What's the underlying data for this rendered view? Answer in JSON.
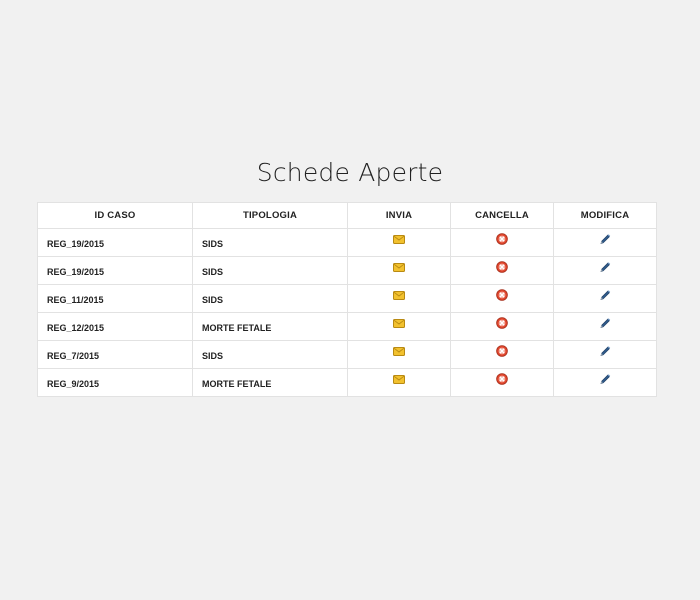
{
  "page": {
    "title": "Schede Aperte"
  },
  "table": {
    "headers": {
      "id_caso": "ID CASO",
      "tipologia": "TIPOLOGIA",
      "invia": "INVIA",
      "cancella": "CANCELLA",
      "modifica": "MODIFICA"
    },
    "rows": [
      {
        "id_caso": "REG_19/2015",
        "tipologia": "SIDS"
      },
      {
        "id_caso": "REG_19/2015",
        "tipologia": "SIDS"
      },
      {
        "id_caso": "REG_11/2015",
        "tipologia": "SIDS"
      },
      {
        "id_caso": "REG_12/2015",
        "tipologia": "MORTE FETALE"
      },
      {
        "id_caso": "REG_7/2015",
        "tipologia": "SIDS"
      },
      {
        "id_caso": "REG_9/2015",
        "tipologia": "MORTE FETALE"
      }
    ],
    "icons": {
      "invia": "envelope-icon",
      "cancella": "delete-circle-icon",
      "modifica": "pen-icon"
    }
  },
  "colors": {
    "background": "#f1f1f1",
    "envelope": "#f2c12e",
    "delete": "#e0452c",
    "pen": "#2f5a8a"
  }
}
